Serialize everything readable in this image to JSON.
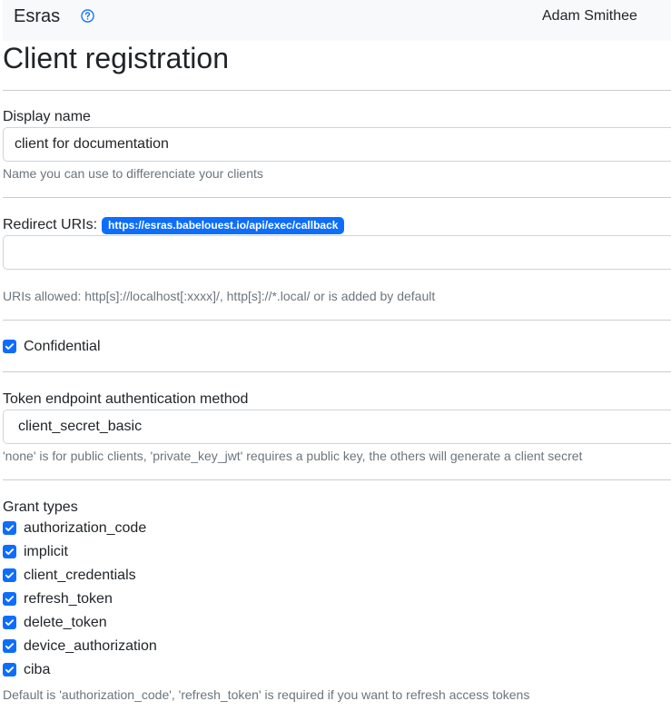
{
  "app": {
    "brand": "Esras",
    "user": "Adam Smithee"
  },
  "page": {
    "title": "Client registration"
  },
  "display_name": {
    "label": "Display name",
    "value": "client for documentation",
    "help": "Name you can use to differenciate your clients"
  },
  "redirect": {
    "label": "Redirect URIs:",
    "badge": "https://esras.babelouest.io/api/exec/callback",
    "value": "",
    "help": "URIs allowed: http[s]://localhost[:xxxx]/, http[s]://*.local/ or is added by default"
  },
  "confidential": {
    "label": "Confidential",
    "checked": true
  },
  "token_auth": {
    "label": "Token endpoint authentication method",
    "selected": "client_secret_basic",
    "help": "'none' is for public clients, 'private_key_jwt' requires a public key, the others will generate a client secret"
  },
  "grant_types": {
    "label": "Grant types",
    "items": [
      {
        "label": "authorization_code",
        "checked": true
      },
      {
        "label": "implicit",
        "checked": true
      },
      {
        "label": "client_credentials",
        "checked": true
      },
      {
        "label": "refresh_token",
        "checked": true
      },
      {
        "label": "delete_token",
        "checked": true
      },
      {
        "label": "device_authorization",
        "checked": true
      },
      {
        "label": "ciba",
        "checked": true
      }
    ],
    "help": "Default is 'authorization_code', 'refresh_token' is required if you want to refresh access tokens"
  },
  "colors": {
    "accent": "#0d6efd",
    "muted": "#6c757d",
    "navbar_bg": "#f8f9fa"
  }
}
